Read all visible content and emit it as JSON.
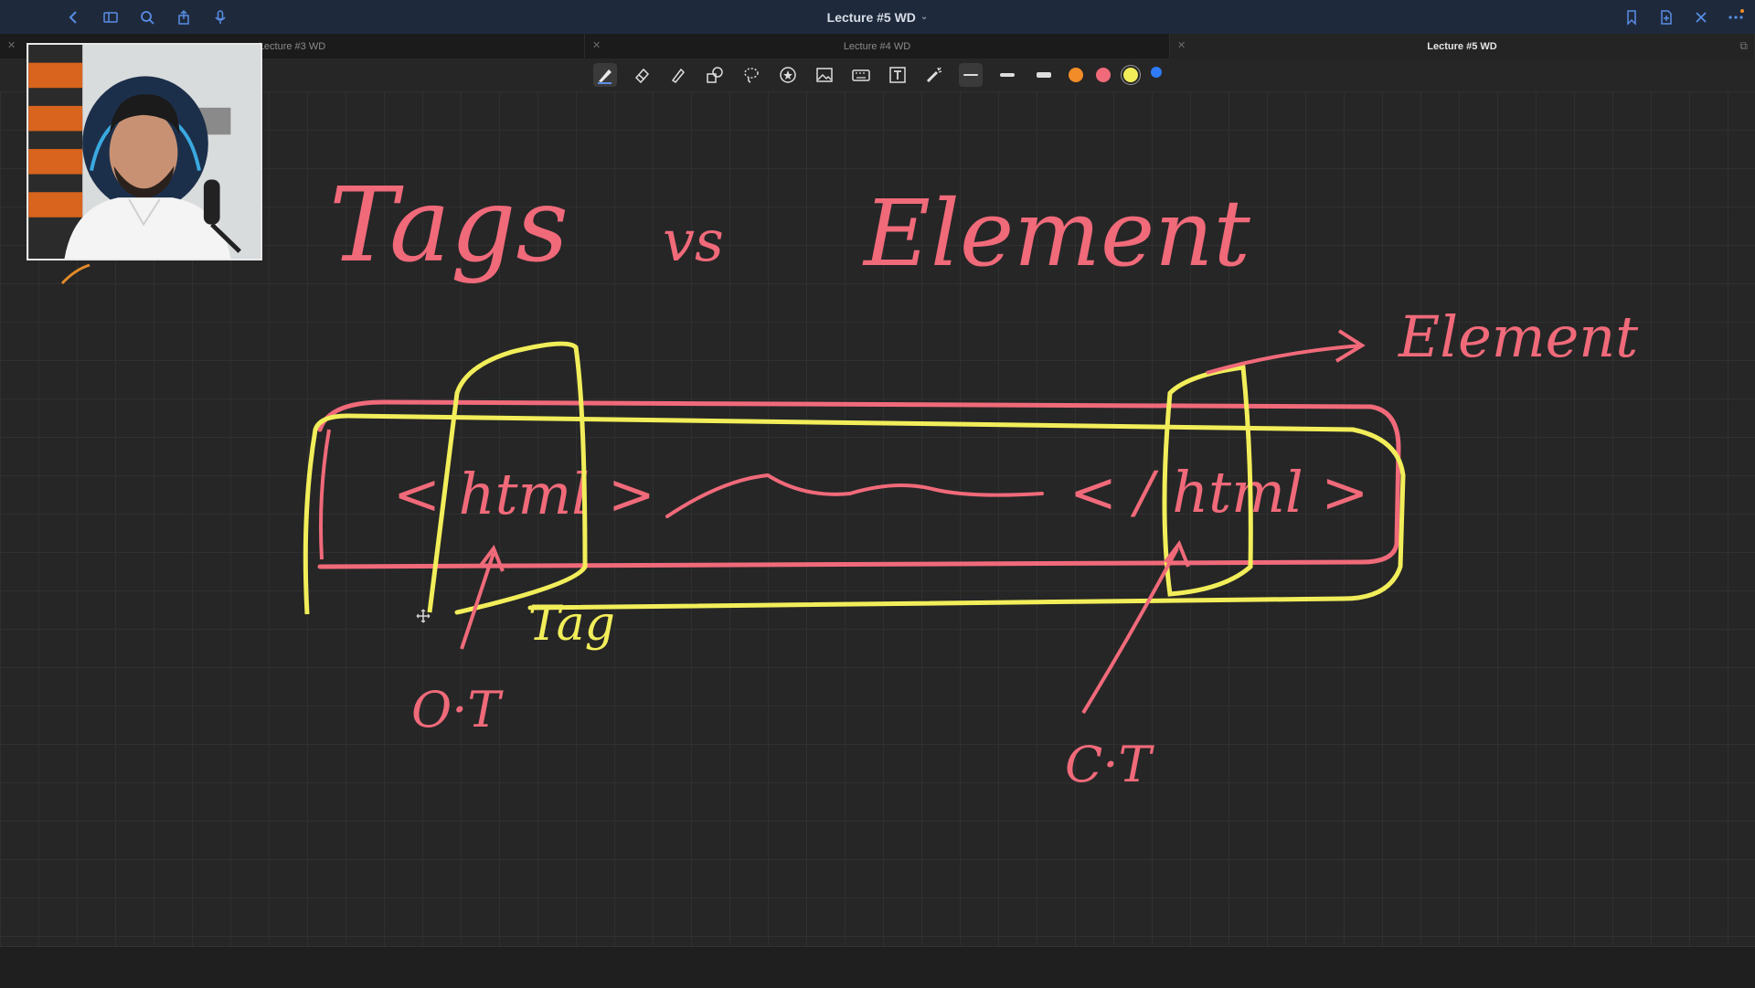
{
  "window": {
    "title": "Lecture #5 WD",
    "title_chevron": "⌄"
  },
  "tabs": [
    {
      "label": "Lecture #3 WD",
      "active": false
    },
    {
      "label": "Lecture #4 WD",
      "active": false
    },
    {
      "label": "Lecture #5 WD",
      "active": true
    }
  ],
  "icons": {
    "left": [
      "back-icon",
      "sidebar-icon",
      "search-icon",
      "share-icon",
      "microphone-icon"
    ],
    "right": [
      "bookmark-icon",
      "new-page-icon",
      "close-icon",
      "more-icon"
    ]
  },
  "toolbar": {
    "tools": [
      "pen-tool",
      "eraser-tool",
      "highlighter-tool",
      "shapes-tool",
      "lasso-tool",
      "sticker-tool",
      "image-tool",
      "keyboard-tool",
      "text-tool",
      "laser-pointer-tool"
    ],
    "stroke_widths": [
      "thin",
      "medium",
      "thick"
    ],
    "colors": [
      "#f28c28",
      "#f06a7a",
      "#f2ee5a",
      "#2f7bf5"
    ]
  },
  "handwriting": {
    "title_left": "Tags",
    "title_mid": "vs",
    "title_right": "Element",
    "arrow_label": "Element",
    "open_tag": "< html >",
    "close_tag": "< / html >",
    "tag_label": "Tag",
    "open_tag_abbr": "O·T",
    "close_tag_abbr": "C·T"
  },
  "colors": {
    "ink_pink": "#f06a7a",
    "ink_yellow": "#f2ee5a",
    "ink_orange": "#e58a2a",
    "titlebar": "#1e2a3c"
  }
}
